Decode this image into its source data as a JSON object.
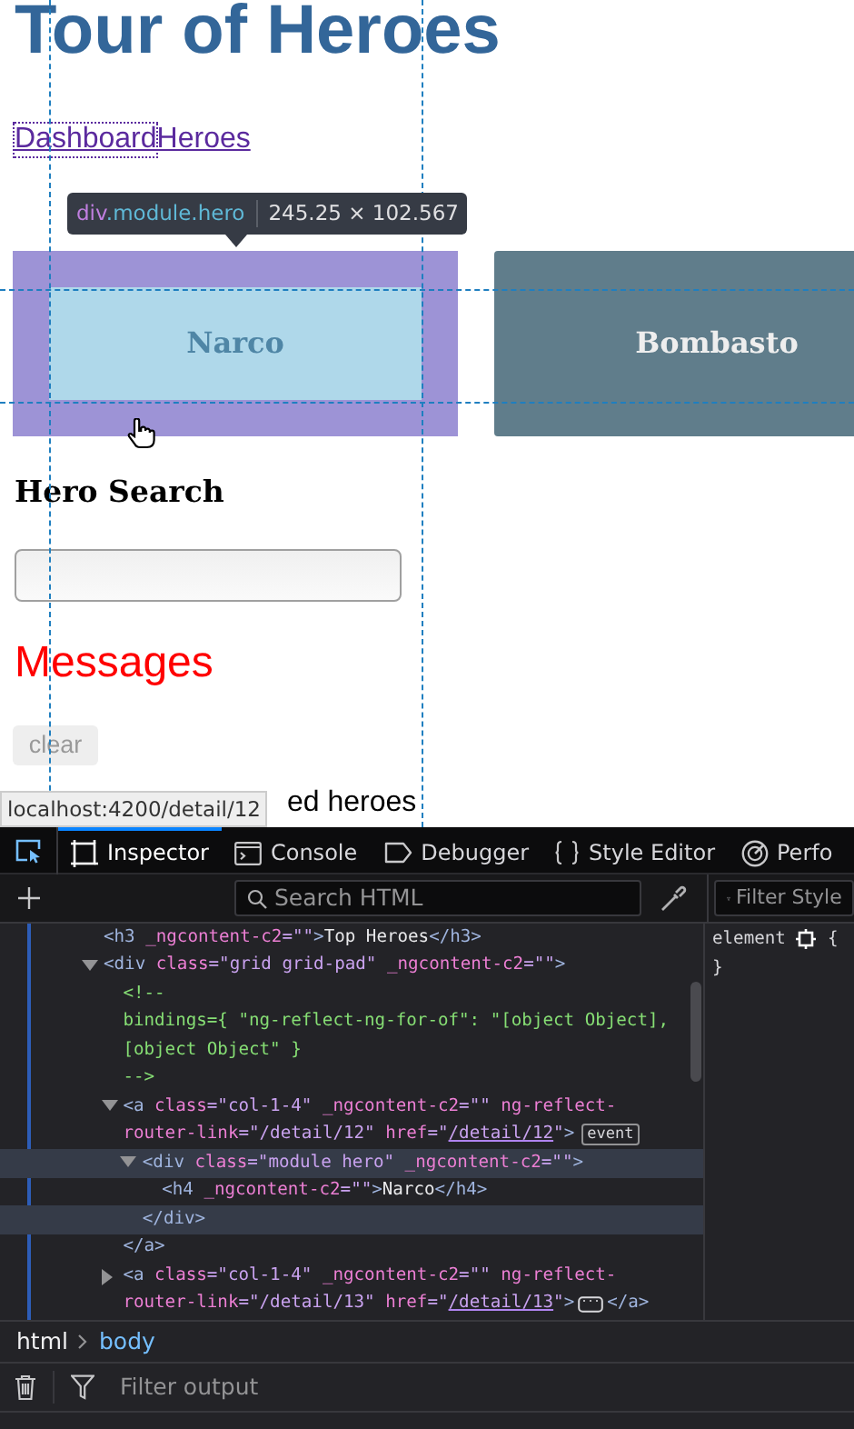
{
  "page": {
    "title": "Tour of Heroes",
    "nav": [
      {
        "label": "Dashboard",
        "focused": true
      },
      {
        "label": "Heroes",
        "focused": false
      }
    ],
    "inspector_tooltip": {
      "tag": "div",
      "classes": ".module.hero",
      "size": "245.25 × 102.567"
    },
    "heroes": [
      {
        "name": "Narco",
        "highlighted": true
      },
      {
        "name": "Bombasto",
        "highlighted": false
      }
    ],
    "search_heading": "Hero Search",
    "messages_heading": "Messages",
    "clear_button": "clear",
    "messages": [
      "ed heroes"
    ],
    "status_url": "localhost:4200/detail/12"
  },
  "devtools": {
    "tabs": [
      {
        "label": "Inspector",
        "selected": true
      },
      {
        "label": "Console",
        "selected": false
      },
      {
        "label": "Debugger",
        "selected": false
      },
      {
        "label": "Style Editor",
        "selected": false
      },
      {
        "label": "Perfo",
        "selected": false
      }
    ],
    "markup_search": {
      "placeholder": "Search HTML"
    },
    "styles_filter": {
      "placeholder": "Filter Style"
    },
    "markup": [
      {
        "lines": [
          [
            {
              "kind": "tag",
              "text": "<h3"
            },
            {
              "kind": "attr",
              "text": " _ngcontent-c2"
            },
            {
              "kind": "value",
              "text": "=\"\""
            },
            {
              "kind": "tag",
              "text": ">"
            },
            {
              "kind": "text",
              "text": "Top Heroes"
            },
            {
              "kind": "tag",
              "text": "</h3>"
            }
          ]
        ],
        "selected": false
      },
      {
        "lines": [
          [
            {
              "kind": "tag",
              "text": "<div"
            },
            {
              "kind": "attr",
              "text": " class"
            },
            {
              "kind": "value",
              "text": "=\"grid grid-pad\""
            },
            {
              "kind": "attr",
              "text": " _ngcontent-c2"
            },
            {
              "kind": "value",
              "text": "=\"\""
            },
            {
              "kind": "tag",
              "text": ">"
            }
          ]
        ],
        "selected": false,
        "expanded": true,
        "children": [
          {
            "lines": [
              [
                {
                  "kind": "comment",
                  "text": "<!--"
                }
              ],
              [
                {
                  "kind": "comment",
                  "text": "bindings={ \"ng-reflect-ng-for-of\": \"[object Object],"
                }
              ],
              [
                {
                  "kind": "comment",
                  "text": "[object Object\" }"
                }
              ],
              [
                {
                  "kind": "comment",
                  "text": "-->"
                }
              ]
            ],
            "selected": false
          },
          {
            "lines": [
              [
                {
                  "kind": "tag",
                  "text": "<a"
                },
                {
                  "kind": "attr",
                  "text": " class"
                },
                {
                  "kind": "value",
                  "text": "=\"col-1-4\""
                },
                {
                  "kind": "attr",
                  "text": " _ngcontent-c2"
                },
                {
                  "kind": "value",
                  "text": "=\"\""
                },
                {
                  "kind": "attr",
                  "text": " ng-reflect-"
                }
              ],
              [
                {
                  "kind": "attr",
                  "text": "router-link"
                },
                {
                  "kind": "value",
                  "text": "=\"/detail/12\""
                },
                {
                  "kind": "attr",
                  "text": " href"
                },
                {
                  "kind": "value",
                  "text": "=\""
                },
                {
                  "kind": "link",
                  "text": "/detail/12"
                },
                {
                  "kind": "value",
                  "text": "\""
                },
                {
                  "kind": "tag",
                  "text": ">"
                },
                {
                  "kind": "badge",
                  "text": "event"
                }
              ]
            ],
            "selected": false,
            "expanded": true,
            "children": [
              {
                "lines": [
                  [
                    {
                      "kind": "tag",
                      "text": "<div"
                    },
                    {
                      "kind": "attr",
                      "text": " class"
                    },
                    {
                      "kind": "value",
                      "text": "=\"module hero\""
                    },
                    {
                      "kind": "attr",
                      "text": " _ngcontent-c2"
                    },
                    {
                      "kind": "value",
                      "text": "=\"\""
                    },
                    {
                      "kind": "tag",
                      "text": ">"
                    }
                  ]
                ],
                "selected": true,
                "expanded": true,
                "children": [
                  {
                    "lines": [
                      [
                        {
                          "kind": "tag",
                          "text": "<h4"
                        },
                        {
                          "kind": "attr",
                          "text": " _ngcontent-c2"
                        },
                        {
                          "kind": "value",
                          "text": "=\"\""
                        },
                        {
                          "kind": "tag",
                          "text": ">"
                        },
                        {
                          "kind": "text",
                          "text": "Narco"
                        },
                        {
                          "kind": "tag",
                          "text": "</h4>"
                        }
                      ]
                    ],
                    "selected": false
                  }
                ],
                "closing": [
                  {
                    "kind": "tag",
                    "text": "</div>"
                  }
                ]
              }
            ],
            "closing": [
              {
                "kind": "tag",
                "text": "</a>"
              }
            ]
          },
          {
            "lines": [
              [
                {
                  "kind": "tag",
                  "text": "<a"
                },
                {
                  "kind": "attr",
                  "text": " class"
                },
                {
                  "kind": "value",
                  "text": "=\"col-1-4\""
                },
                {
                  "kind": "attr",
                  "text": " _ngcontent-c2"
                },
                {
                  "kind": "value",
                  "text": "=\"\""
                },
                {
                  "kind": "attr",
                  "text": " ng-reflect-"
                }
              ],
              [
                {
                  "kind": "attr",
                  "text": "router-link"
                },
                {
                  "kind": "value",
                  "text": "=\"/detail/13\""
                },
                {
                  "kind": "attr",
                  "text": " href"
                },
                {
                  "kind": "value",
                  "text": "=\""
                },
                {
                  "kind": "link",
                  "text": "/detail/13"
                },
                {
                  "kind": "value",
                  "text": "\""
                },
                {
                  "kind": "tag",
                  "text": ">"
                },
                {
                  "kind": "ellipsis"
                },
                {
                  "kind": "tag",
                  "text": "</a>"
                }
              ]
            ],
            "selected": false,
            "expanded": false
          }
        ]
      }
    ],
    "rules": {
      "selector": "element",
      "open": "{",
      "close": "}"
    },
    "breadcrumbs": [
      {
        "label": "html",
        "selected": false
      },
      {
        "label": "body",
        "selected": true
      }
    ],
    "console_filter": {
      "placeholder": "Filter output"
    }
  }
}
